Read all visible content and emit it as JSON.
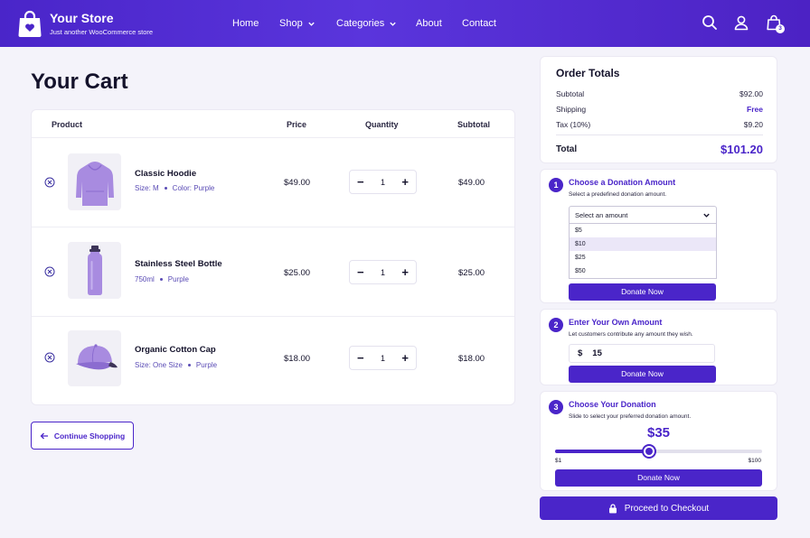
{
  "brand": {
    "name": "Your Store",
    "tagline": "Just another WooCommerce store"
  },
  "nav": [
    {
      "label": "Home"
    },
    {
      "label": "Shop"
    },
    {
      "label": "Categories"
    },
    {
      "label": "About"
    },
    {
      "label": "Contact"
    }
  ],
  "header_icons": {
    "search": "search-icon",
    "account": "user-icon",
    "cart": "shopping-bag-icon",
    "cart_count": "3"
  },
  "page": {
    "title": "Your Cart"
  },
  "table": {
    "headers": {
      "product": "Product",
      "price": "Price",
      "quantity": "Quantity",
      "subtotal": "Subtotal"
    },
    "items": [
      {
        "name": "Classic Hoodie",
        "meta1": "Size: M",
        "meta2": "Color: Purple",
        "price": "$49.00",
        "qty": "1",
        "subtotal": "$49.00",
        "image": "hoodie"
      },
      {
        "name": "Stainless Steel Bottle",
        "meta1": "750ml",
        "meta2": "Purple",
        "price": "$25.00",
        "qty": "1",
        "subtotal": "$25.00",
        "image": "bottle"
      },
      {
        "name": "Organic Cotton Cap",
        "meta1": "Size: One Size",
        "meta2": "Purple",
        "price": "$18.00",
        "qty": "1",
        "subtotal": "$18.00",
        "image": "cap"
      }
    ]
  },
  "continue_label": "Continue Shopping",
  "totals": {
    "title": "Order Totals",
    "subtotal_label": "Subtotal",
    "subtotal": "$92.00",
    "shipping_label": "Shipping",
    "shipping": "Free",
    "tax_label": "Tax (10%)",
    "tax": "$9.20",
    "total_label": "Total",
    "total": "$101.20"
  },
  "donation1": {
    "num": "1",
    "title": "Choose a Donation Amount",
    "desc": "Select a predefined donation amount.",
    "select_placeholder": "Select an amount",
    "options": [
      "$5",
      "$10",
      "$25",
      "$50"
    ],
    "highlighted": "$10",
    "button": "Donate Now"
  },
  "donation2": {
    "num": "2",
    "title": "Enter Your Own Amount",
    "desc": "Let customers contribute any amount they wish.",
    "currency": "$",
    "value": "15",
    "button": "Donate Now"
  },
  "donation3": {
    "num": "3",
    "title": "Choose Your Donation",
    "desc": "Slide to select your preferred donation amount.",
    "amount": "$35",
    "min_label": "$1",
    "max_label": "$100",
    "min": 1,
    "max": 100,
    "value": 46,
    "button": "Donate Now"
  },
  "checkout_label": "Proceed to Checkout",
  "colors": {
    "brand": "#4a25c9",
    "background": "#f4f3fa",
    "product": "#a88be0"
  }
}
